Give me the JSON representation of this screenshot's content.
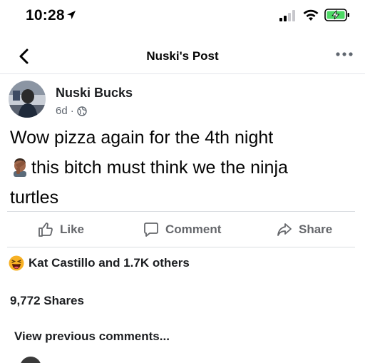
{
  "status_bar": {
    "time": "10:28",
    "icons": [
      "location-arrow-icon",
      "cell-signal-icon",
      "wifi-icon",
      "battery-charging-icon"
    ]
  },
  "nav": {
    "title": "Nuski's Post",
    "back_icon": "chevron-left-icon",
    "more_icon": "more-dots-icon"
  },
  "post": {
    "author": "Nuski Bucks",
    "age": "6d",
    "separator": "·",
    "privacy_icon": "globe-icon",
    "text_line1": "Wow pizza again for the 4th night",
    "text_line2": "this bitch must think we the ninja",
    "text_line3": "turtles",
    "emoji": "man-facepalming-emoji"
  },
  "actions": {
    "like_label": "Like",
    "comment_label": "Comment",
    "share_label": "Share"
  },
  "reactions": {
    "icon": "haha-reaction-icon",
    "summary": "Kat Castillo and 1.7K others"
  },
  "shares": {
    "label": "9,772 Shares"
  },
  "comments": {
    "view_previous": "View previous comments..."
  },
  "colors": {
    "text_primary": "#050505",
    "text_secondary": "#65676b",
    "divider": "#dadde1",
    "battery_green": "#4cd964",
    "haha_yellow": "#f7b125"
  }
}
